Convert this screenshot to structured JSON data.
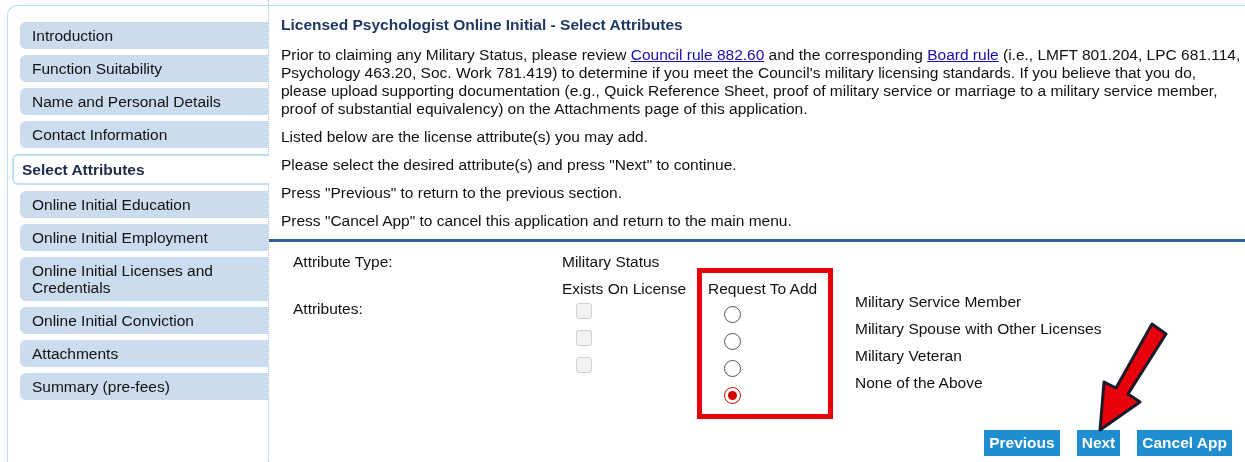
{
  "sidebar": {
    "items": [
      {
        "label": "Introduction",
        "selected": false
      },
      {
        "label": "Function Suitability",
        "selected": false
      },
      {
        "label": "Name and Personal Details",
        "selected": false
      },
      {
        "label": "Contact Information",
        "selected": false
      },
      {
        "label": "Select Attributes",
        "selected": true
      },
      {
        "label": "Online Initial Education",
        "selected": false
      },
      {
        "label": "Online Initial Employment",
        "selected": false
      },
      {
        "label": "Online Initial Licenses and Credentials",
        "selected": false
      },
      {
        "label": "Online Initial Conviction",
        "selected": false
      },
      {
        "label": "Attachments",
        "selected": false
      },
      {
        "label": "Summary (pre-fees)",
        "selected": false
      }
    ]
  },
  "main": {
    "title": "Licensed Psychologist Online Initial - Select Attributes",
    "intro": {
      "before": "Prior to claiming any Military Status, please review ",
      "link1": "Council rule 882.60",
      "middle": " and the corresponding ",
      "link2": "Board rule",
      "after": " (i.e., LMFT 801.204, LPC 681.114, Psychology 463.20, Soc. Work 781.419) to determine if you meet the Council's military licensing standards. If you believe that you do, please upload supporting documentation (e.g., Quick Reference Sheet, proof of military service or marriage to a military service member, proof of substantial equivalency) on the Attachments page of this application."
    },
    "instructions": [
      "Listed below are the license attribute(s) you may add.",
      "Please select the desired attribute(s) and press \"Next\" to continue.",
      "Press \"Previous\" to return to the previous section.",
      "Press \"Cancel App\" to cancel this application and return to the main menu."
    ],
    "attribute_type_label": "Attribute Type:",
    "attribute_type_value": "Military Status",
    "attributes_label": "Attributes:",
    "exists_header": "Exists On License",
    "request_header": "Request To Add",
    "attributes": [
      {
        "label": "Military Service Member",
        "exists": false,
        "selected": false
      },
      {
        "label": "Military Spouse with Other Licenses",
        "exists": false,
        "selected": false
      },
      {
        "label": "Military Veteran",
        "exists": false,
        "selected": false
      },
      {
        "label": "None of the Above",
        "selected": true
      }
    ],
    "buttons": [
      "Previous",
      "Next",
      "Cancel App"
    ]
  }
}
